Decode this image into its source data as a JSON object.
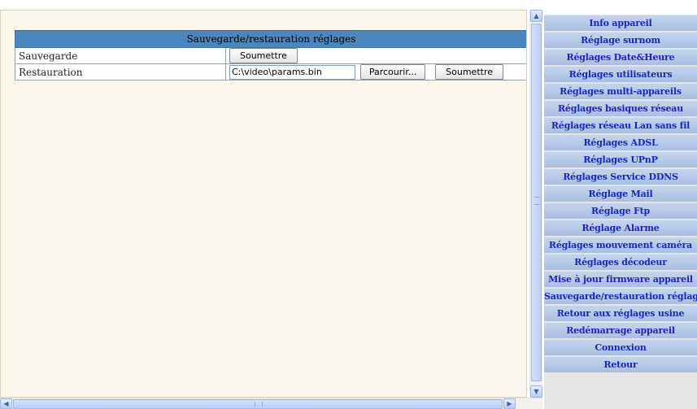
{
  "panel": {
    "title": "Sauvegarde/restauration réglages",
    "rows": [
      {
        "label": "Sauvegarde",
        "submit_label": "Soumettre"
      },
      {
        "label": "Restauration",
        "file_value": "C:\\video\\params.bin",
        "browse_label": "Parcourir...",
        "submit_label": "Soumettre"
      }
    ]
  },
  "sidebar": {
    "items": [
      {
        "label": "Info appareil"
      },
      {
        "label": "Réglage surnom"
      },
      {
        "label": "Réglages Date&Heure"
      },
      {
        "label": "Réglages utilisateurs"
      },
      {
        "label": "Réglages multi-appareils"
      },
      {
        "label": "Réglages basiques réseau"
      },
      {
        "label": "Réglages réseau Lan sans fil"
      },
      {
        "label": "Réglages ADSL"
      },
      {
        "label": "Réglages UPnP"
      },
      {
        "label": "Réglages Service DDNS"
      },
      {
        "label": "Réglage Mail"
      },
      {
        "label": "Réglage Ftp"
      },
      {
        "label": "Réglage Alarme"
      },
      {
        "label": "Réglages mouvement caméra"
      },
      {
        "label": "Réglages décodeur"
      },
      {
        "label": "Mise à jour firmware appareil"
      },
      {
        "label": "Sauvegarde/restauration réglage"
      },
      {
        "label": "Retour aux réglages usine"
      },
      {
        "label": "Redémarrage appareil"
      },
      {
        "label": "Connexion"
      },
      {
        "label": "Retour"
      }
    ]
  },
  "icons": {
    "scroll_up": "▲",
    "scroll_down": "▼",
    "scroll_left": "◀",
    "scroll_right": "▶"
  },
  "colors": {
    "panel_header": "#4c86bd",
    "sidebar_item_bg": "#b7c9e6",
    "sidebar_item_text": "#1a24c8"
  }
}
